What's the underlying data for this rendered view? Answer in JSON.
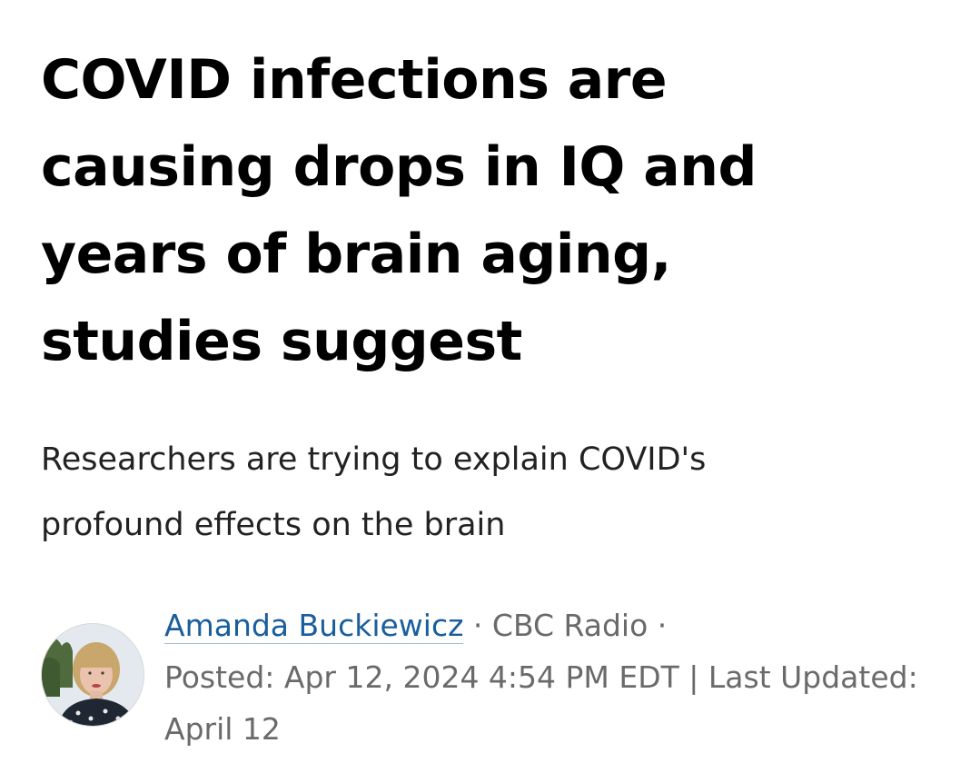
{
  "article": {
    "headline": "COVID infections are causing drops in IQ and years of brain aging, studies suggest",
    "deck": "Researchers are trying to explain COVID's profound effects on the brain"
  },
  "byline": {
    "author": "Amanda Buckiewicz",
    "separator": "·",
    "outlet": "CBC Radio",
    "posted": "Posted: Apr 12, 2024 4:54 PM EDT | Last Updated: April 12"
  },
  "colors": {
    "headline": "#000000",
    "author_link": "#1a5e9c",
    "meta_text": "#6a6a6a"
  }
}
